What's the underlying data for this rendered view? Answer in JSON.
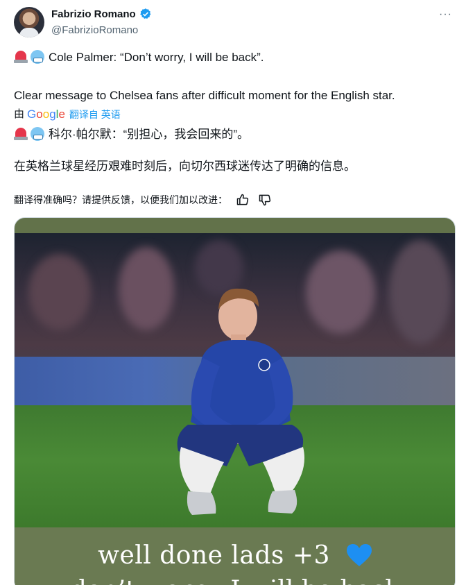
{
  "author": {
    "name": "Fabrizio Romano",
    "handle": "@FabrizioRomano",
    "verified_icon": "verified-badge-icon",
    "more_icon": "more-options-icon"
  },
  "tweet": {
    "line1": "Cole Palmer: “Don’t worry, I will be back”.",
    "line2": "Clear message to Chelsea fans after difficult moment for the English star."
  },
  "translation": {
    "by_label": "由",
    "provider": "Google",
    "link_text": "翻译自 英语",
    "line1": "科尔·帕尔默：“别担心，我会回来的”。",
    "line2": "在英格兰球星经历艰难时刻后，向切尔西球迷传达了明确的信息。"
  },
  "feedback": {
    "prompt": "翻译得准确吗？请提供反馈，以便我们加以改进：",
    "like_icon": "thumbs-up-icon",
    "dislike_icon": "thumbs-down-icon"
  },
  "media": {
    "caption_line1": "well done lads +3",
    "caption_line2": "don’t worry, I will be back",
    "heart_icon": "blue-heart-icon"
  },
  "colors": {
    "accent": "#1d9bf0",
    "text": "#0f1419",
    "secondary": "#536471"
  }
}
